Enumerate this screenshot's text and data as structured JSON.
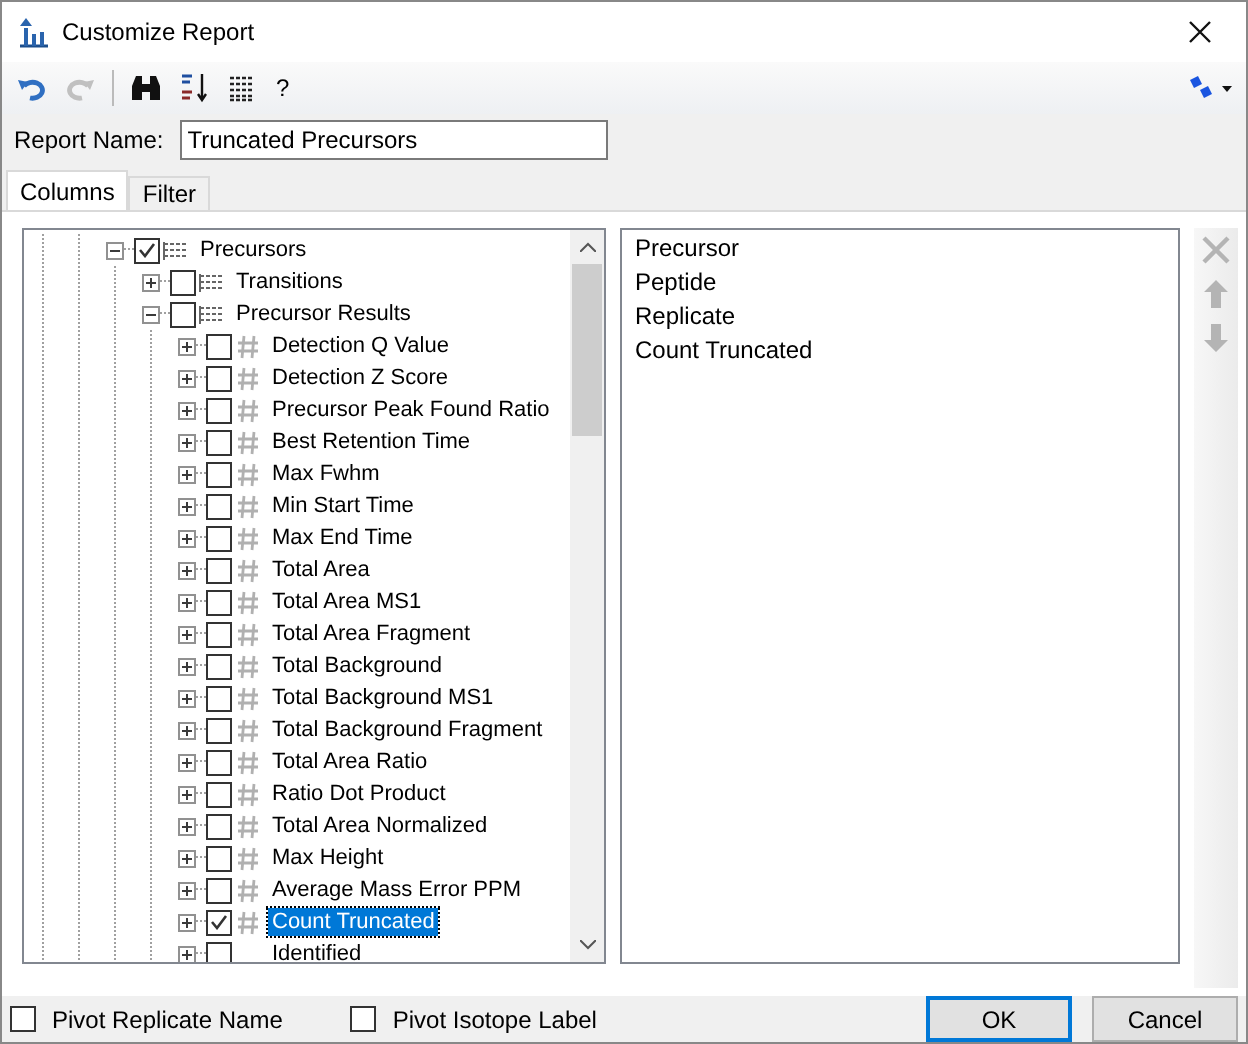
{
  "window": {
    "title": "Customize Report"
  },
  "toolbar": {
    "buttons": [
      {
        "kind": "undo",
        "disabled": false
      },
      {
        "kind": "redo",
        "disabled": true
      },
      {
        "kind": "find",
        "disabled": false
      },
      {
        "kind": "sort",
        "disabled": false
      },
      {
        "kind": "list",
        "disabled": false
      }
    ],
    "help": "?"
  },
  "report_name": {
    "label": "Report Name:",
    "value": "Truncated Precursors"
  },
  "tabs": [
    {
      "label": "Columns",
      "selected": true
    },
    {
      "label": "Filter",
      "selected": false
    }
  ],
  "tree": [
    {
      "label": "Precursors",
      "kind": "table",
      "checked": true,
      "expanded": true,
      "selected": false,
      "children": [
        {
          "label": "Transitions",
          "kind": "table",
          "checked": false,
          "expanded": false,
          "selected": false
        },
        {
          "label": "Precursor Results",
          "kind": "table",
          "checked": false,
          "expanded": true,
          "selected": false,
          "children": [
            {
              "label": "Detection Q Value",
              "kind": "number",
              "checked": false,
              "expanded": false,
              "selected": false
            },
            {
              "label": "Detection Z Score",
              "kind": "number",
              "checked": false,
              "expanded": false,
              "selected": false
            },
            {
              "label": "Precursor Peak Found Ratio",
              "kind": "number",
              "checked": false,
              "expanded": false,
              "selected": false
            },
            {
              "label": "Best Retention Time",
              "kind": "number",
              "checked": false,
              "expanded": false,
              "selected": false
            },
            {
              "label": "Max Fwhm",
              "kind": "number",
              "checked": false,
              "expanded": false,
              "selected": false
            },
            {
              "label": "Min Start Time",
              "kind": "number",
              "checked": false,
              "expanded": false,
              "selected": false
            },
            {
              "label": "Max End Time",
              "kind": "number",
              "checked": false,
              "expanded": false,
              "selected": false
            },
            {
              "label": "Total Area",
              "kind": "number",
              "checked": false,
              "expanded": false,
              "selected": false
            },
            {
              "label": "Total Area MS1",
              "kind": "number",
              "checked": false,
              "expanded": false,
              "selected": false
            },
            {
              "label": "Total Area Fragment",
              "kind": "number",
              "checked": false,
              "expanded": false,
              "selected": false
            },
            {
              "label": "Total Background",
              "kind": "number",
              "checked": false,
              "expanded": false,
              "selected": false
            },
            {
              "label": "Total Background MS1",
              "kind": "number",
              "checked": false,
              "expanded": false,
              "selected": false
            },
            {
              "label": "Total Background Fragment",
              "kind": "number",
              "checked": false,
              "expanded": false,
              "selected": false
            },
            {
              "label": "Total Area Ratio",
              "kind": "number",
              "checked": false,
              "expanded": false,
              "selected": false
            },
            {
              "label": "Ratio Dot Product",
              "kind": "number",
              "checked": false,
              "expanded": false,
              "selected": false
            },
            {
              "label": "Total Area Normalized",
              "kind": "number",
              "checked": false,
              "expanded": false,
              "selected": false
            },
            {
              "label": "Max Height",
              "kind": "number",
              "checked": false,
              "expanded": false,
              "selected": false
            },
            {
              "label": "Average Mass Error PPM",
              "kind": "number",
              "checked": false,
              "expanded": false,
              "selected": false
            },
            {
              "label": "Count Truncated",
              "kind": "number",
              "checked": true,
              "expanded": false,
              "selected": true
            },
            {
              "label": "Identified",
              "kind": "plain",
              "checked": false,
              "expanded": false,
              "selected": false
            }
          ]
        }
      ]
    }
  ],
  "selected_columns": [
    "Precursor",
    "Peptide",
    "Replicate",
    "Count Truncated"
  ],
  "side_buttons": [
    {
      "kind": "delete",
      "disabled": true
    },
    {
      "kind": "up",
      "disabled": true
    },
    {
      "kind": "down",
      "disabled": true
    }
  ],
  "options": [
    {
      "label": "Pivot Replicate Name",
      "checked": false
    },
    {
      "label": "Pivot Isotope Label",
      "checked": false
    }
  ],
  "buttons": [
    {
      "label": "OK",
      "default": true
    },
    {
      "label": "Cancel",
      "default": false
    }
  ]
}
